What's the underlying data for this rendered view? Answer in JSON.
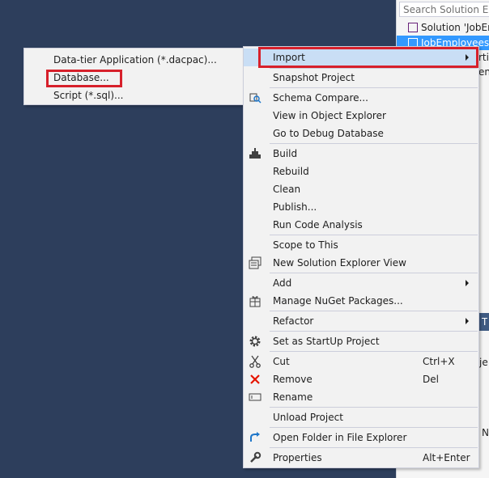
{
  "solution_explorer": {
    "search_placeholder": "Search Solution Explorer",
    "rows": [
      {
        "label": "Solution 'JobEmployees'",
        "selected": false
      },
      {
        "label": "JobEmployees",
        "selected": true
      }
    ],
    "fragments": [
      "rtie",
      "enc",
      "T",
      "je",
      "N"
    ]
  },
  "submenu": {
    "items": [
      {
        "label": "Data-tier Application (*.dacpac)..."
      },
      {
        "label": "Database..."
      },
      {
        "label": "Script (*.sql)..."
      }
    ]
  },
  "context_menu": {
    "items": [
      {
        "label": "Import",
        "arrow": true,
        "icon": ""
      },
      {
        "label": "Snapshot Project",
        "icon": ""
      },
      {
        "label": "Schema Compare...",
        "icon": "schema-compare-icon"
      },
      {
        "label": "View in Object Explorer",
        "icon": ""
      },
      {
        "label": "Go to Debug Database",
        "icon": ""
      },
      {
        "label": "Build",
        "icon": "build-icon"
      },
      {
        "label": "Rebuild",
        "icon": ""
      },
      {
        "label": "Clean",
        "icon": ""
      },
      {
        "label": "Publish...",
        "icon": ""
      },
      {
        "label": "Run Code Analysis",
        "icon": ""
      },
      {
        "label": "Scope to This",
        "icon": ""
      },
      {
        "label": "New Solution Explorer View",
        "icon": "new-view-icon"
      },
      {
        "label": "Add",
        "arrow": true,
        "icon": ""
      },
      {
        "label": "Manage NuGet Packages...",
        "icon": "nuget-icon"
      },
      {
        "label": "Refactor",
        "arrow": true,
        "icon": ""
      },
      {
        "label": "Set as StartUp Project",
        "icon": "gear-icon"
      },
      {
        "label": "Cut",
        "shortcut": "Ctrl+X",
        "icon": "scissors-icon"
      },
      {
        "label": "Remove",
        "shortcut": "Del",
        "icon": "red-x-icon"
      },
      {
        "label": "Rename",
        "icon": "rename-icon"
      },
      {
        "label": "Unload Project",
        "icon": ""
      },
      {
        "label": "Open Folder in File Explorer",
        "icon": "refresh-arrow-icon"
      },
      {
        "label": "Properties",
        "shortcut": "Alt+Enter",
        "icon": "wrench-icon"
      }
    ]
  },
  "colors": {
    "background": "#2d3e5c",
    "highlight": "#d7202b",
    "selection": "#3399ff",
    "hover": "#c9def5"
  }
}
